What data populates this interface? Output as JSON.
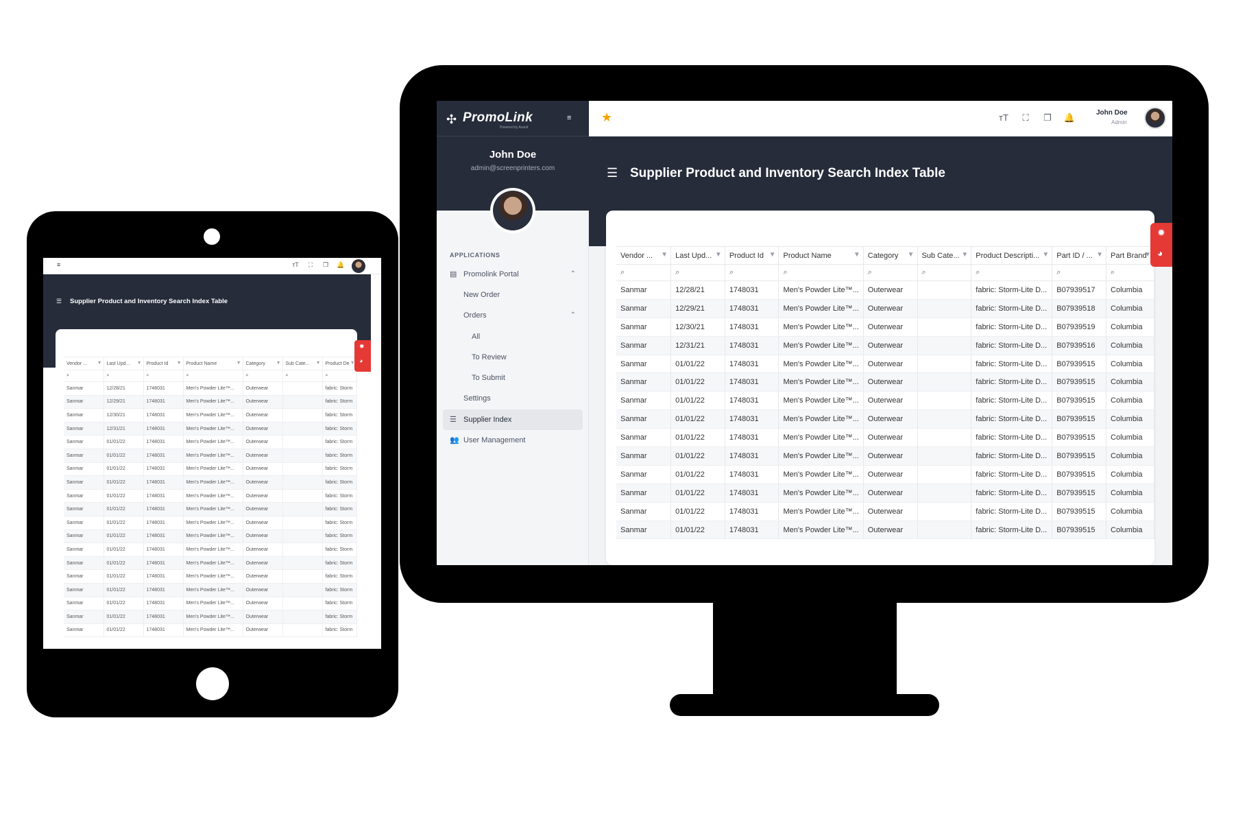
{
  "app": {
    "logo_text": "PromoLink",
    "logo_sub": "Powered by Avanti",
    "page_title": "Supplier Product and Inventory Search Index Table"
  },
  "sidebar": {
    "user_name": "John Doe",
    "user_email": "admin@screenprinters.com",
    "section_label": "APPLICATIONS",
    "items": [
      {
        "label": "Promolink Portal",
        "icon": "grid-icon",
        "chevron": "⌃"
      },
      {
        "label": "New Order"
      },
      {
        "label": "Orders",
        "chevron": "⌃"
      },
      {
        "label": "All"
      },
      {
        "label": "To Review"
      },
      {
        "label": "To Submit"
      },
      {
        "label": "Settings"
      },
      {
        "label": "Supplier Index",
        "icon": "list-icon",
        "active": true
      },
      {
        "label": "User Management",
        "icon": "users-icon"
      }
    ]
  },
  "topbar": {
    "user_name": "John Doe",
    "user_role": "Admin",
    "icons": [
      "favorite-star-icon",
      "font-size-icon",
      "fullscreen-icon",
      "bookmarks-icon",
      "notifications-bell-icon"
    ]
  },
  "table": {
    "columns": [
      "Vendor ...",
      "Last Upd...",
      "Product Id",
      "Product Name",
      "Category",
      "Sub Cate...",
      "Product Descripti...",
      "Part ID / ...",
      "Part Brand"
    ],
    "rows": [
      [
        "Sanmar",
        "12/28/21",
        "1748031",
        "Men's Powder Lite™...",
        "Outerwear",
        "",
        "fabric: Storm-Lite D...",
        "B07939517",
        "Columbia"
      ],
      [
        "Sanmar",
        "12/29/21",
        "1748031",
        "Men's Powder Lite™...",
        "Outerwear",
        "",
        "fabric: Storm-Lite D...",
        "B07939518",
        "Columbia"
      ],
      [
        "Sanmar",
        "12/30/21",
        "1748031",
        "Men's Powder Lite™...",
        "Outerwear",
        "",
        "fabric: Storm-Lite D...",
        "B07939519",
        "Columbia"
      ],
      [
        "Sanmar",
        "12/31/21",
        "1748031",
        "Men's Powder Lite™...",
        "Outerwear",
        "",
        "fabric: Storm-Lite D...",
        "B07939516",
        "Columbia"
      ],
      [
        "Sanmar",
        "01/01/22",
        "1748031",
        "Men's Powder Lite™...",
        "Outerwear",
        "",
        "fabric: Storm-Lite D...",
        "B07939515",
        "Columbia"
      ],
      [
        "Sanmar",
        "01/01/22",
        "1748031",
        "Men's Powder Lite™...",
        "Outerwear",
        "",
        "fabric: Storm-Lite D...",
        "B07939515",
        "Columbia"
      ],
      [
        "Sanmar",
        "01/01/22",
        "1748031",
        "Men's Powder Lite™...",
        "Outerwear",
        "",
        "fabric: Storm-Lite D...",
        "B07939515",
        "Columbia"
      ],
      [
        "Sanmar",
        "01/01/22",
        "1748031",
        "Men's Powder Lite™...",
        "Outerwear",
        "",
        "fabric: Storm-Lite D...",
        "B07939515",
        "Columbia"
      ],
      [
        "Sanmar",
        "01/01/22",
        "1748031",
        "Men's Powder Lite™...",
        "Outerwear",
        "",
        "fabric: Storm-Lite D...",
        "B07939515",
        "Columbia"
      ],
      [
        "Sanmar",
        "01/01/22",
        "1748031",
        "Men's Powder Lite™...",
        "Outerwear",
        "",
        "fabric: Storm-Lite D...",
        "B07939515",
        "Columbia"
      ],
      [
        "Sanmar",
        "01/01/22",
        "1748031",
        "Men's Powder Lite™...",
        "Outerwear",
        "",
        "fabric: Storm-Lite D...",
        "B07939515",
        "Columbia"
      ],
      [
        "Sanmar",
        "01/01/22",
        "1748031",
        "Men's Powder Lite™...",
        "Outerwear",
        "",
        "fabric: Storm-Lite D...",
        "B07939515",
        "Columbia"
      ],
      [
        "Sanmar",
        "01/01/22",
        "1748031",
        "Men's Powder Lite™...",
        "Outerwear",
        "",
        "fabric: Storm-Lite D...",
        "B07939515",
        "Columbia"
      ],
      [
        "Sanmar",
        "01/01/22",
        "1748031",
        "Men's Powder Lite™...",
        "Outerwear",
        "",
        "fabric: Storm-Lite D...",
        "B07939515",
        "Columbia"
      ]
    ]
  },
  "tablet_table": {
    "columns": [
      "Vendor ...",
      "Last Upd...",
      "Product Id",
      "Product Name",
      "Category",
      "Sub Cate...",
      "Product De"
    ],
    "rows": [
      [
        "Sanmar",
        "12/28/21",
        "1748031",
        "Men's Powder Lite™...",
        "Outerwear",
        "",
        "fabric: Storm"
      ],
      [
        "Sanmar",
        "12/29/21",
        "1748031",
        "Men's Powder Lite™...",
        "Outerwear",
        "",
        "fabric: Storm"
      ],
      [
        "Sanmar",
        "12/30/21",
        "1748031",
        "Men's Powder Lite™...",
        "Outerwear",
        "",
        "fabric: Storm"
      ],
      [
        "Sanmar",
        "12/31/21",
        "1748031",
        "Men's Powder Lite™...",
        "Outerwear",
        "",
        "fabric: Storm"
      ],
      [
        "Sanmar",
        "01/01/22",
        "1748031",
        "Men's Powder Lite™...",
        "Outerwear",
        "",
        "fabric: Storm"
      ],
      [
        "Sanmar",
        "01/01/22",
        "1748031",
        "Men's Powder Lite™...",
        "Outerwear",
        "",
        "fabric: Storm"
      ],
      [
        "Sanmar",
        "01/01/22",
        "1748031",
        "Men's Powder Lite™...",
        "Outerwear",
        "",
        "fabric: Storm"
      ],
      [
        "Sanmar",
        "01/01/22",
        "1748031",
        "Men's Powder Lite™...",
        "Outerwear",
        "",
        "fabric: Storm"
      ],
      [
        "Sanmar",
        "01/01/22",
        "1748031",
        "Men's Powder Lite™...",
        "Outerwear",
        "",
        "fabric: Storm"
      ],
      [
        "Sanmar",
        "01/01/22",
        "1748031",
        "Men's Powder Lite™...",
        "Outerwear",
        "",
        "fabric: Storm"
      ],
      [
        "Sanmar",
        "01/01/22",
        "1748031",
        "Men's Powder Lite™...",
        "Outerwear",
        "",
        "fabric: Storm"
      ],
      [
        "Sanmar",
        "01/01/22",
        "1748031",
        "Men's Powder Lite™...",
        "Outerwear",
        "",
        "fabric: Storm"
      ],
      [
        "Sanmar",
        "01/01/22",
        "1748031",
        "Men's Powder Lite™...",
        "Outerwear",
        "",
        "fabric: Storm"
      ],
      [
        "Sanmar",
        "01/01/22",
        "1748031",
        "Men's Powder Lite™...",
        "Outerwear",
        "",
        "fabric: Storm"
      ],
      [
        "Sanmar",
        "01/01/22",
        "1748031",
        "Men's Powder Lite™...",
        "Outerwear",
        "",
        "fabric: Storm"
      ],
      [
        "Sanmar",
        "01/01/22",
        "1748031",
        "Men's Powder Lite™...",
        "Outerwear",
        "",
        "fabric: Storm"
      ],
      [
        "Sanmar",
        "01/01/22",
        "1748031",
        "Men's Powder Lite™...",
        "Outerwear",
        "",
        "fabric: Storm"
      ],
      [
        "Sanmar",
        "01/01/22",
        "1748031",
        "Men's Powder Lite™...",
        "Outerwear",
        "",
        "fabric: Storm"
      ],
      [
        "Sanmar",
        "01/01/22",
        "1748031",
        "Men's Powder Lite™...",
        "Outerwear",
        "",
        "fabric: Storm"
      ]
    ]
  },
  "colors": {
    "dark_navy": "#262c3a",
    "accent_red": "#e53935",
    "star": "#f4a300"
  }
}
